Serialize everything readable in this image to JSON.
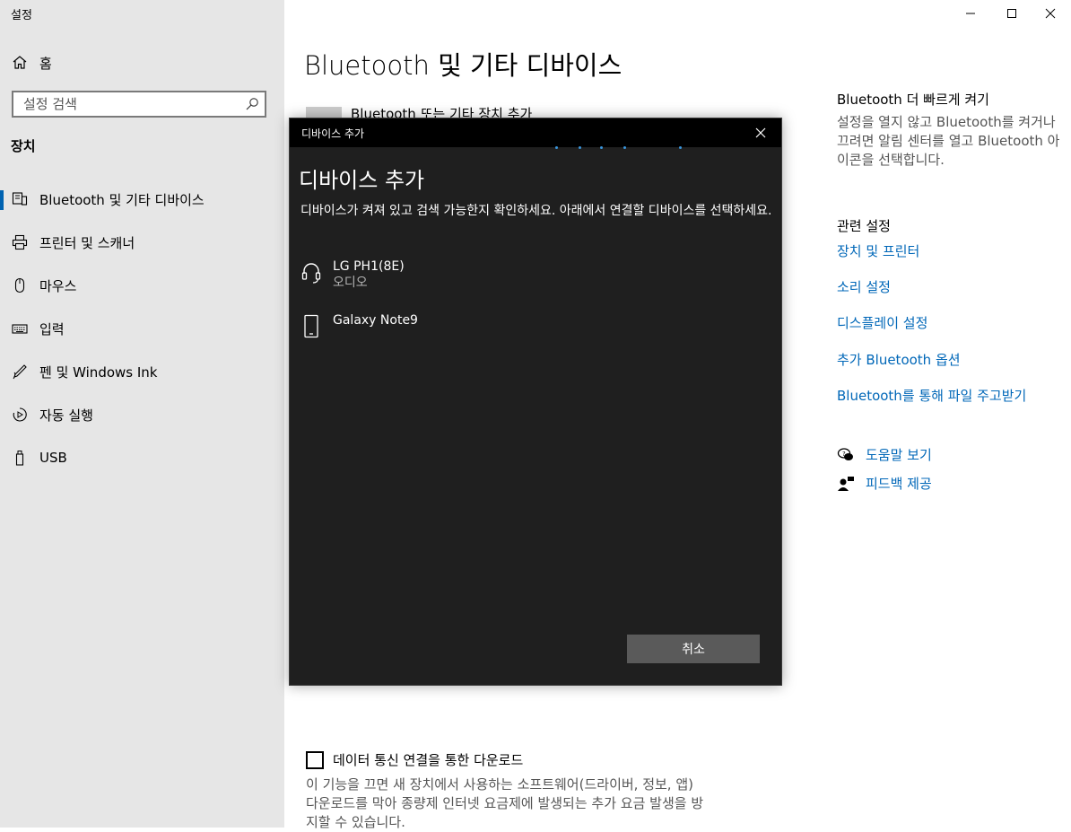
{
  "window": {
    "title": "설정"
  },
  "nav": {
    "home": "홈",
    "search_placeholder": "설정 검색",
    "section": "장치",
    "items": [
      {
        "label": "Bluetooth 및 기타 디바이스",
        "icon": "bluetooth-devices-icon",
        "selected": true
      },
      {
        "label": "프린터 및 스캐너",
        "icon": "printer-icon"
      },
      {
        "label": "마우스",
        "icon": "mouse-icon"
      },
      {
        "label": "입력",
        "icon": "keyboard-icon"
      },
      {
        "label": "펜 및 Windows Ink",
        "icon": "pen-icon"
      },
      {
        "label": "자동 실행",
        "icon": "autoplay-icon"
      },
      {
        "label": "USB",
        "icon": "usb-icon"
      }
    ]
  },
  "main": {
    "title": "Bluetooth 및 기타 디바이스",
    "add_device": "Bluetooth 또는 기타 장치 추가",
    "metered_checkbox": "데이터 통신 연결을 통한 다운로드",
    "metered_desc": "이 기능을 끄면 새 장치에서 사용하는 소프트웨어(드라이버, 정보, 앱) 다운로드를 막아 종량제 인터넷 요금제에 발생되는 추가 요금 발생을 방지할 수 있습니다."
  },
  "right": {
    "quick_title": "Bluetooth 더 빠르게 켜기",
    "quick_text": "설정을 열지 않고 Bluetooth를 켜거나 끄려면 알림 센터를 열고 Bluetooth 아이콘을 선택합니다.",
    "related_title": "관련 설정",
    "links": [
      "장치 및 프린터",
      "소리 설정",
      "디스플레이 설정",
      "추가 Bluetooth 옵션",
      "Bluetooth를 통해 파일 주고받기"
    ],
    "help": "도움말 보기",
    "feedback": "피드백 제공"
  },
  "dialog": {
    "title": "디바이스 추가",
    "heading": "디바이스 추가",
    "instruction": "디바이스가 켜져 있고 검색 가능한지 확인하세요. 아래에서 연결할 디바이스를 선택하세요.",
    "devices": [
      {
        "name": "LG PH1(8E)",
        "type": "오디오",
        "icon": "headset-icon"
      },
      {
        "name": "Galaxy Note9",
        "type": "",
        "icon": "phone-icon"
      }
    ],
    "cancel": "취소"
  },
  "colors": {
    "accent": "#0067b8",
    "nav_bg": "#e6e6e6",
    "dialog_bg": "#1f1f1f",
    "progress": "#3a96dd"
  }
}
